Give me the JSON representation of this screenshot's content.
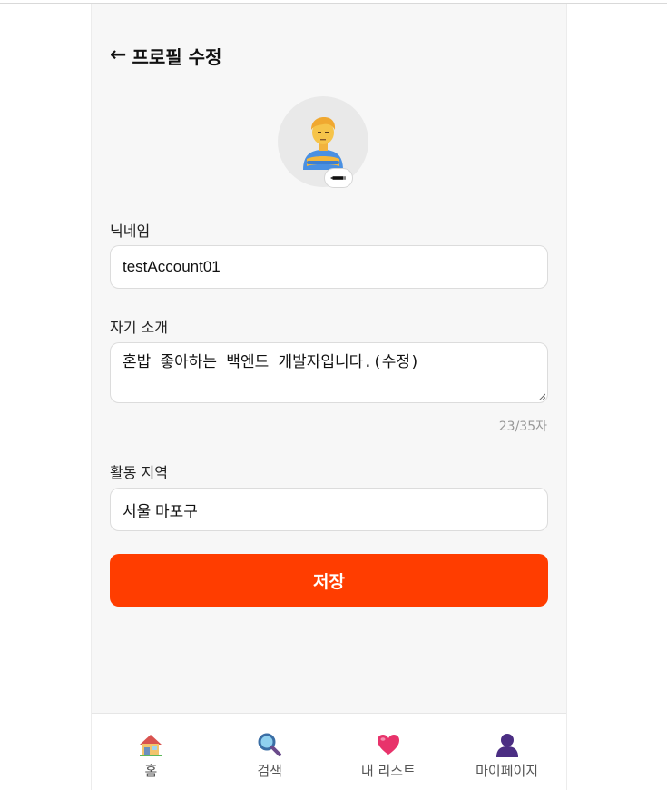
{
  "header": {
    "back_icon": "left-arrow-icon",
    "back_glyph": "←",
    "title": "프로필 수정"
  },
  "profile": {
    "avatar_icon": "person-emoji-icon",
    "edit_icon": "pencil-icon"
  },
  "nickname": {
    "label": "닉네임",
    "value": "testAccount01"
  },
  "bio": {
    "label": "자기 소개",
    "value": "혼밥 좋아하는 백엔드 개발자입니다.(수정)",
    "counter": "23/35자"
  },
  "region": {
    "label": "활동 지역",
    "value": "서울 마포구"
  },
  "save_button": {
    "label": "저장",
    "color": "#ff3d00"
  },
  "bottom_nav": [
    {
      "label": "홈",
      "icon": "house-icon"
    },
    {
      "label": "검색",
      "icon": "magnifier-icon"
    },
    {
      "label": "내 리스트",
      "icon": "heart-icon"
    },
    {
      "label": "마이페이지",
      "icon": "user-icon"
    }
  ]
}
